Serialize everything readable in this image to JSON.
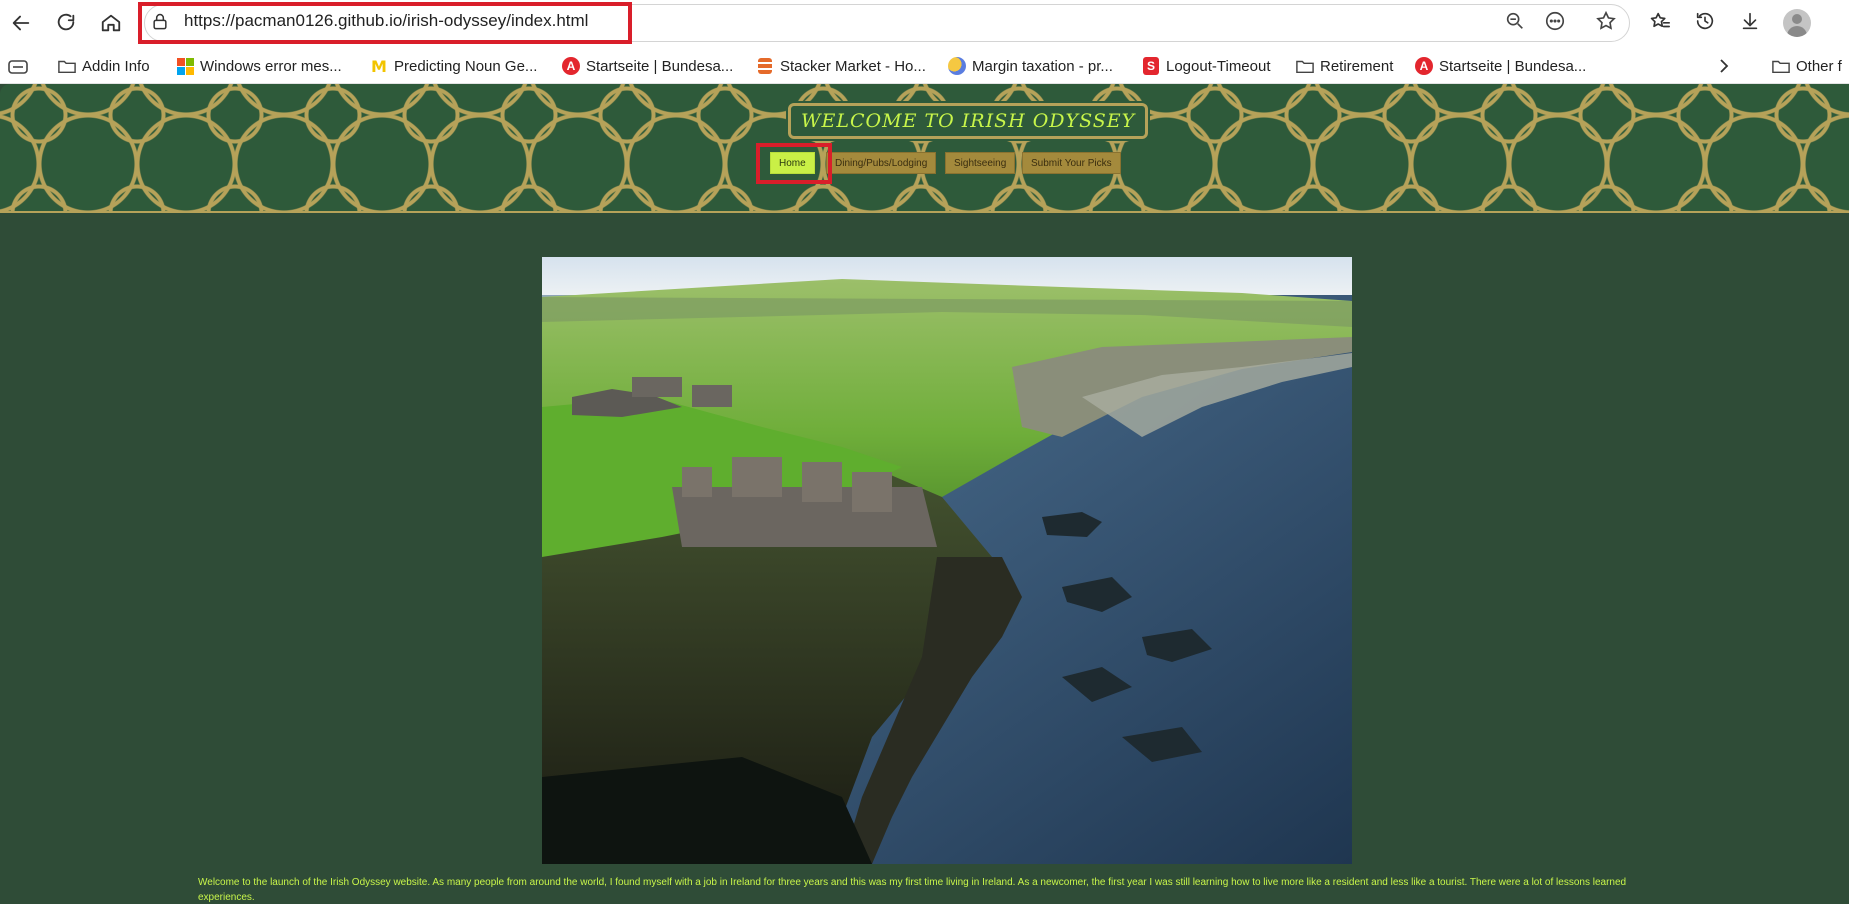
{
  "browser": {
    "url": "https://pacman0126.github.io/irish-odyssey/index.html",
    "bookmarks": [
      {
        "label": "Addin Info",
        "icon": "folder-icon"
      },
      {
        "label": "Windows error mes...",
        "icon": "microsoft-icon"
      },
      {
        "label": "Predicting Noun Ge...",
        "icon": "michigan-m-icon"
      },
      {
        "label": "Startseite | Bundesa...",
        "icon": "arbeitsagentur-icon"
      },
      {
        "label": "Stacker Market - Ho...",
        "icon": "stacker-icon"
      },
      {
        "label": "Margin taxation - pr...",
        "icon": "coin-icon"
      },
      {
        "label": "Logout-Timeout",
        "icon": "sparkasse-icon"
      },
      {
        "label": "Retirement",
        "icon": "folder-icon"
      },
      {
        "label": "Startseite | Bundesa...",
        "icon": "arbeitsagentur-icon"
      },
      {
        "label": "Other f",
        "icon": "folder-icon"
      }
    ]
  },
  "site": {
    "title": "WELCOME TO IRISH ODYSSEY",
    "nav": [
      {
        "label": "Home",
        "active": true
      },
      {
        "label": "Dining/Pubs/Lodging",
        "active": false
      },
      {
        "label": "Sightseeing",
        "active": false
      },
      {
        "label": "Submit Your Picks",
        "active": false
      }
    ],
    "intro": "Welcome to the launch of the Irish Odyssey website. As many people from around the world, I found myself with a job in Ireland for three years and this was my first time living in Ireland. As a newcomer, the first year I was still learning how to live more like a resident and less like a tourist. There were a lot of lessons learned experiences."
  },
  "colors": {
    "page_bg": "#2f4c37",
    "accent_text": "#c8f54a",
    "gold": "#b6a259",
    "highlight_red": "#d91e2a"
  }
}
